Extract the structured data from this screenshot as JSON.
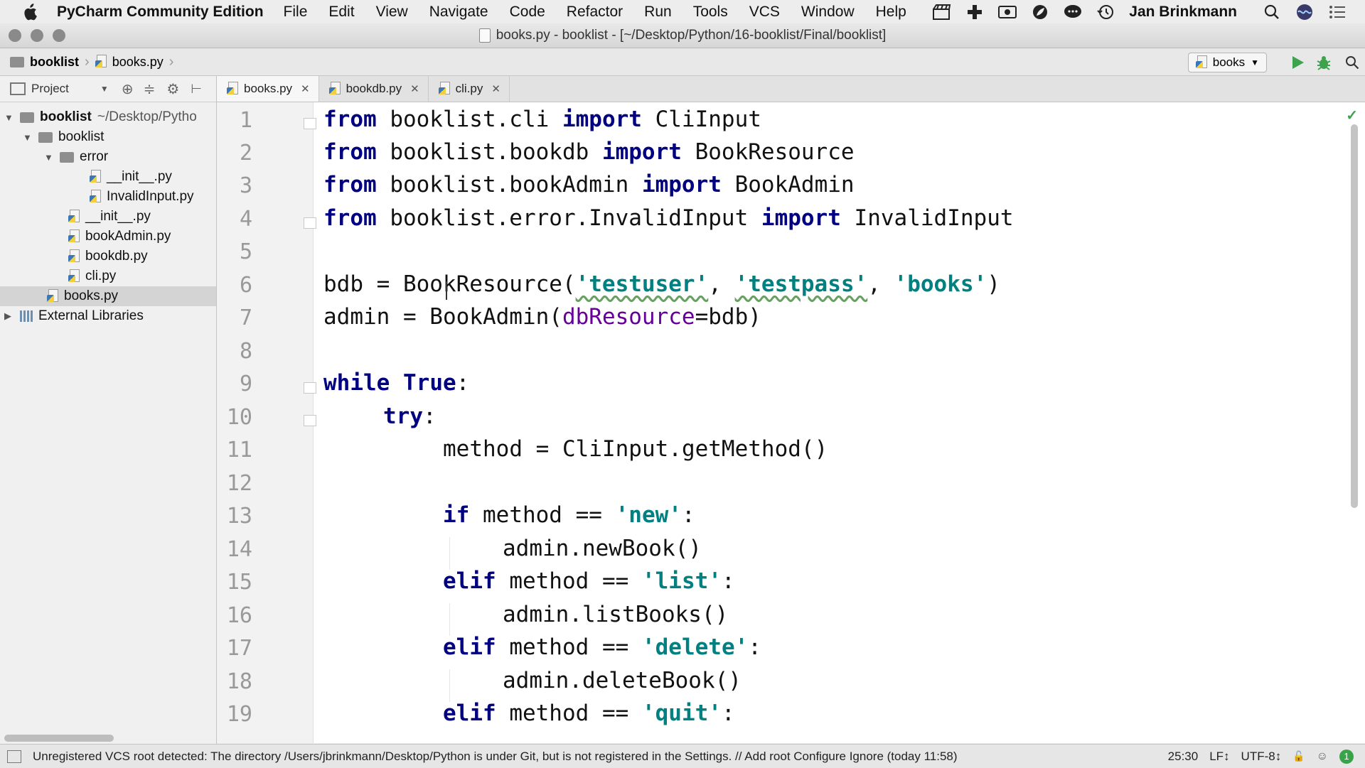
{
  "menubar": {
    "app_name": "PyCharm Community Edition",
    "items": [
      "File",
      "Edit",
      "View",
      "Navigate",
      "Code",
      "Refactor",
      "Run",
      "Tools",
      "VCS",
      "Window",
      "Help"
    ],
    "user": "Jan Brinkmann"
  },
  "window": {
    "title": "books.py - booklist - [~/Desktop/Python/16-booklist/Final/booklist]"
  },
  "breadcrumb": {
    "project": "booklist",
    "file": "books.py"
  },
  "run_config": {
    "label": "books"
  },
  "sidebar": {
    "tool_label": "Project",
    "tree": {
      "root_name": "booklist",
      "root_path": "~/Desktop/Pytho",
      "booklist_pkg": "booklist",
      "error_pkg": "error",
      "error_init": "__init__.py",
      "invalid_input": "InvalidInput.py",
      "pkg_init": "__init__.py",
      "book_admin": "bookAdmin.py",
      "bookdb": "bookdb.py",
      "cli": "cli.py",
      "books": "books.py",
      "external": "External Libraries"
    }
  },
  "tabs": [
    {
      "label": "books.py"
    },
    {
      "label": "bookdb.py"
    },
    {
      "label": "cli.py"
    }
  ],
  "editor": {
    "line_numbers": [
      "1",
      "2",
      "3",
      "4",
      "5",
      "6",
      "7",
      "8",
      "9",
      "10",
      "11",
      "12",
      "13",
      "14",
      "15",
      "16",
      "17",
      "18",
      "19"
    ],
    "code": {
      "from": "from",
      "import": "import",
      "l1_mod": " booklist.cli ",
      "l1_name": " CliInput",
      "l2_mod": " booklist.bookdb ",
      "l2_name": " BookResource",
      "l3_mod": " booklist.bookAdmin ",
      "l3_name": " BookAdmin",
      "l4_mod": " booklist.error.InvalidInput ",
      "l4_name": " InvalidInput",
      "l6_start": "bdb = BookResource(",
      "l6_s1": "'testuser'",
      "l6_s2": "'testpass'",
      "l6_s3": "'books'",
      "comma": ", ",
      "close_paren": ")",
      "l7_start": "admin = BookAdmin(",
      "l7_param": "dbResource",
      "l7_end": "=bdb)",
      "while": "while",
      "true": "True",
      "colon": ":",
      "try": "try",
      "l11": "method = CliInput.getMethod()",
      "if": "if",
      "elif": "elif",
      "method_eq": " method == ",
      "s_new": "'new'",
      "s_list": "'list'",
      "s_delete": "'delete'",
      "s_quit": "'quit'",
      "l14": "admin.newBook()",
      "l16": "admin.listBooks()",
      "l18": "admin.deleteBook()"
    }
  },
  "status": {
    "message": "Unregistered VCS root detected: The directory /Users/jbrinkmann/Desktop/Python is under Git, but is not registered in the Settings. // Add root  Configure  Ignore (today 11:58)",
    "position": "25:30",
    "line_sep": "LF↕",
    "encoding": "UTF-8↕",
    "badge": "1"
  }
}
